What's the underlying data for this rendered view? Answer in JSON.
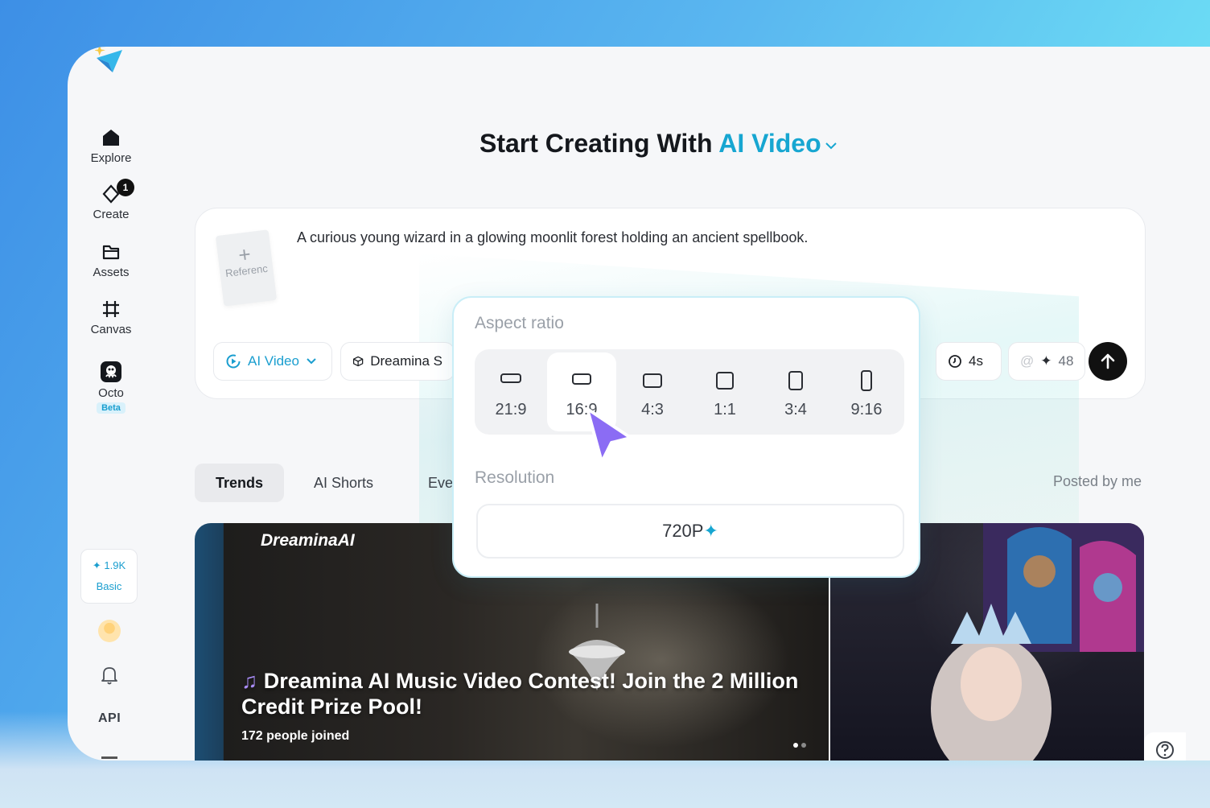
{
  "sidebar": {
    "nav": [
      {
        "label": "Explore",
        "icon": "home-icon"
      },
      {
        "label": "Create",
        "icon": "create-icon",
        "badge": "1"
      },
      {
        "label": "Assets",
        "icon": "folder-icon"
      },
      {
        "label": "Canvas",
        "icon": "canvas-icon"
      },
      {
        "label": "Octo",
        "icon": "octo-icon",
        "tag": "Beta"
      }
    ],
    "credits": {
      "amount": "1.9K",
      "plan": "Basic"
    },
    "api_label": "API"
  },
  "heading": {
    "prefix": "Start Creating With",
    "mode": "AI Video"
  },
  "prompt": {
    "text": "A curious young wizard in a glowing moonlit forest holding an ancient spellbook.",
    "reference_label": "Referenc",
    "reference_plus": "+"
  },
  "toolbar": {
    "mode_label": "AI Video",
    "model_label": "Dreamina S",
    "duration_label": "4s",
    "at_label": "@",
    "credits_label": "48"
  },
  "popup": {
    "aspect_title": "Aspect ratio",
    "aspect_options": [
      "21:9",
      "16:9",
      "4:3",
      "1:1",
      "3:4",
      "9:16"
    ],
    "selected": "16:9",
    "resolution_title": "Resolution",
    "resolution_value": "720P"
  },
  "tabs": {
    "items": [
      "Trends",
      "AI Shorts",
      "Eve"
    ],
    "active": "Trends",
    "posted_by_me": "Posted by me"
  },
  "feature": {
    "logo": "DreaminaAI",
    "title": "Dreamina AI Music Video Contest! Join the 2 Million Credit Prize Pool!",
    "joined": "172 people joined"
  },
  "colors": {
    "accent": "#17a6d1",
    "cursor": "#8b6cf4"
  }
}
